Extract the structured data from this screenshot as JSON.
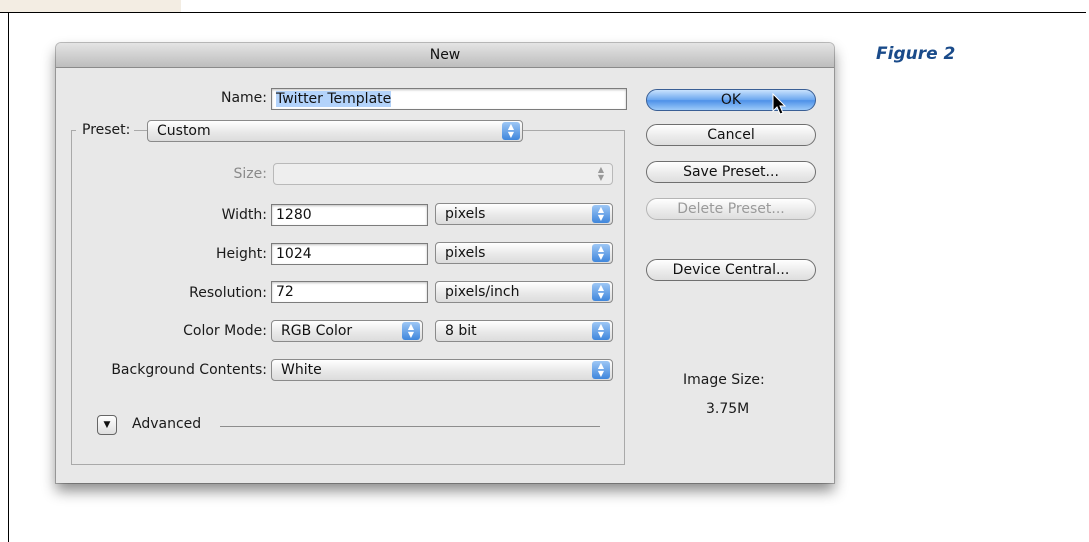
{
  "figure_label": "Figure 2",
  "dialog": {
    "title": "New",
    "name_label": "Name:",
    "name_value": "Twitter Template",
    "preset_label": "Preset:",
    "preset_value": "Custom",
    "size_label": "Size:",
    "size_value": "",
    "width_label": "Width:",
    "width_value": "1280",
    "width_unit": "pixels",
    "height_label": "Height:",
    "height_value": "1024",
    "height_unit": "pixels",
    "resolution_label": "Resolution:",
    "resolution_value": "72",
    "resolution_unit": "pixels/inch",
    "color_mode_label": "Color Mode:",
    "color_mode_value": "RGB Color",
    "bit_depth_value": "8 bit",
    "background_label": "Background Contents:",
    "background_value": "White",
    "advanced_label": "Advanced",
    "buttons": {
      "ok": "OK",
      "cancel": "Cancel",
      "save_preset": "Save Preset...",
      "delete_preset": "Delete Preset...",
      "device_central": "Device Central..."
    },
    "image_size_label": "Image Size:",
    "image_size_value": "3.75M"
  },
  "colors": {
    "figure_label": "#1a4b8a",
    "ok_button": "#4c90e8",
    "selection": "#b3d3fb"
  },
  "icons": {
    "popup_arrows": "up-down-arrows-icon",
    "disclosure": "triangle-down-icon",
    "cursor": "mouse-pointer-icon"
  }
}
